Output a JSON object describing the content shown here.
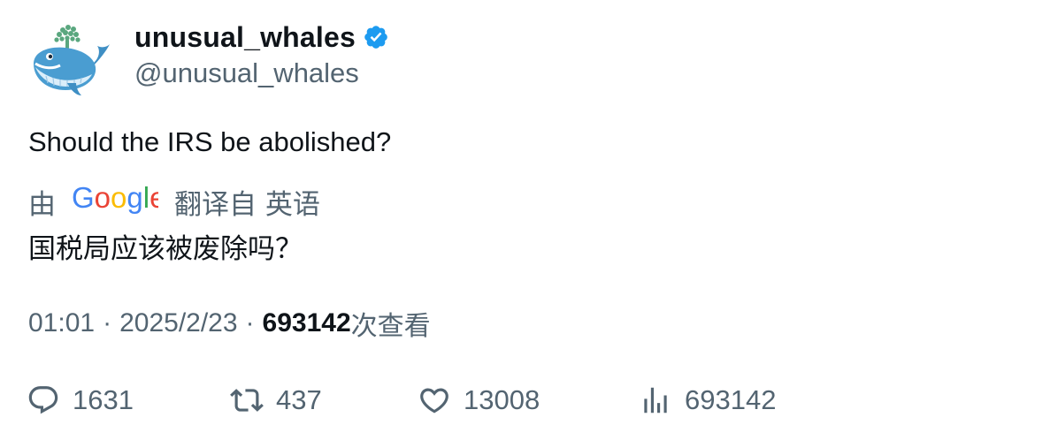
{
  "author": {
    "display_name": "unusual_whales",
    "handle": "@unusual_whales",
    "verified_icon": "verified-badge-icon",
    "avatar_icon": "whale-avatar"
  },
  "tweet": {
    "text": "Should the IRS be abolished?",
    "translation": {
      "prefix": "由",
      "provider_logo": "Google",
      "suffix": "翻译自 英语",
      "text": "国税局应该被废除吗？"
    },
    "time": "01:01",
    "date": "2025/2/23",
    "separator": "·",
    "views_count": "693142",
    "views_label": "次查看"
  },
  "actions": {
    "reply": {
      "icon": "reply-icon",
      "count": "1631"
    },
    "retweet": {
      "icon": "retweet-icon",
      "count": "437"
    },
    "like": {
      "icon": "heart-icon",
      "count": "13008"
    },
    "views": {
      "icon": "analytics-icon",
      "count": "693142"
    }
  },
  "colors": {
    "text_primary": "#0f1419",
    "text_secondary": "#536471",
    "verified_blue": "#1d9bf0"
  }
}
